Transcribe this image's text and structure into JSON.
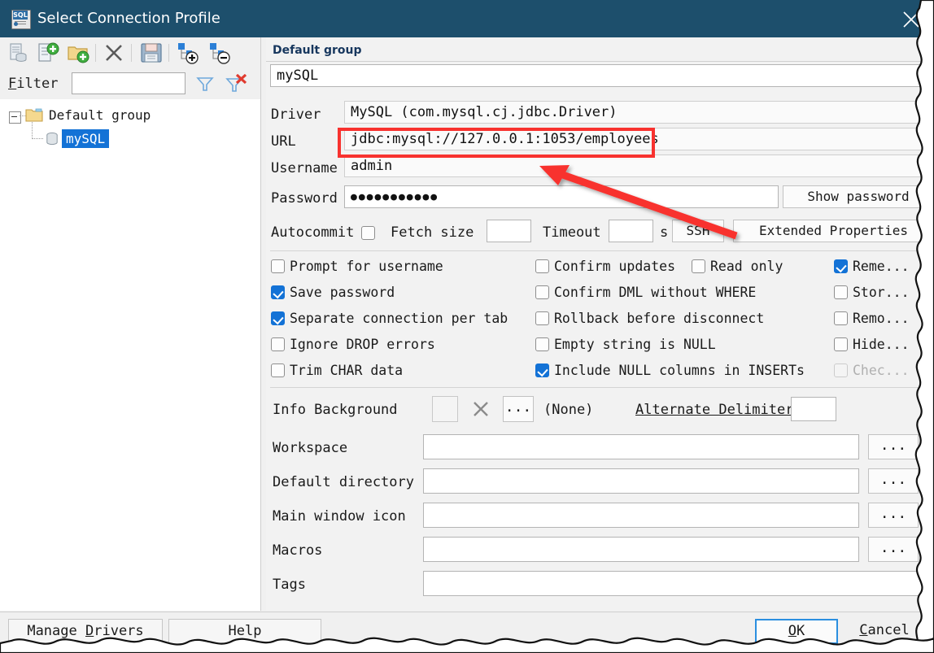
{
  "window": {
    "title": "Select Connection Profile",
    "app_icon": "sql-database-icon",
    "close_icon": "close-icon",
    "titlebar_color": "#1d4f6c"
  },
  "toolbar": {
    "buttons": [
      {
        "name": "copy-profile-button",
        "icon": "database-copy-icon"
      },
      {
        "name": "new-profile-button",
        "icon": "database-add-icon"
      },
      {
        "name": "new-group-button",
        "icon": "folder-add-icon"
      },
      {
        "name": "delete-profile-button",
        "icon": "delete-x-icon"
      },
      {
        "name": "save-profiles-button",
        "icon": "floppy-save-icon"
      },
      {
        "name": "expand-all-button",
        "icon": "tree-expand-icon"
      },
      {
        "name": "collapse-all-button",
        "icon": "tree-collapse-icon"
      }
    ]
  },
  "filter": {
    "label": "Filter",
    "mnemonic": "F",
    "value": "",
    "apply_icon": "funnel-icon",
    "clear_icon": "funnel-clear-icon"
  },
  "tree": {
    "group_label": "Default group",
    "group_icon": "folder-icon",
    "profile_label": "mySQL",
    "profile_icon": "database-icon",
    "selected": "mySQL",
    "selection_color": "#1372d6"
  },
  "details": {
    "group_header": "Default group",
    "profile_name": "mySQL",
    "fields": [
      {
        "label": "Driver",
        "value": "MySQL (com.mysql.cj.jdbc.Driver)"
      },
      {
        "label": "URL",
        "value": "jdbc:mysql://127.0.0.1:1053/employees"
      },
      {
        "label": "Username",
        "value": "admin"
      },
      {
        "label": "Password",
        "value": "●●●●●●●●●●●"
      }
    ],
    "show_password_button": "Show password",
    "options_row": {
      "autocommit_label": "Autocommit",
      "autocommit_checked": false,
      "fetch_size_label": "Fetch size",
      "fetch_size_value": "",
      "timeout_label": "Timeout",
      "timeout_value": "",
      "timeout_unit": "s",
      "ssh_button": "SSH",
      "extended_properties_button": "Extended Properties"
    },
    "checkboxes_col1": [
      {
        "label": "Prompt for username",
        "checked": false,
        "disabled": false
      },
      {
        "label": "Save password",
        "checked": true,
        "disabled": false
      },
      {
        "label": "Separate connection per tab",
        "checked": true,
        "disabled": false
      },
      {
        "label": "Ignore DROP errors",
        "checked": false,
        "disabled": false
      },
      {
        "label": "Trim CHAR data",
        "checked": false,
        "disabled": false
      }
    ],
    "checkboxes_col2": [
      {
        "label": "Confirm updates",
        "checked": false,
        "disabled": false
      },
      {
        "label": "Confirm DML without WHERE",
        "checked": false,
        "disabled": false
      },
      {
        "label": "Rollback before disconnect",
        "checked": false,
        "disabled": false
      },
      {
        "label": "Empty string is NULL",
        "checked": false,
        "disabled": false
      },
      {
        "label": "Include NULL columns in INSERTs",
        "checked": true,
        "disabled": false
      }
    ],
    "checkbox_readonly": {
      "label": "Read only",
      "checked": false,
      "disabled": false
    },
    "checkboxes_col3": [
      {
        "label": "Reme...",
        "checked": true,
        "disabled": false
      },
      {
        "label": "Stor...",
        "checked": false,
        "disabled": false
      },
      {
        "label": "Remo...",
        "checked": false,
        "disabled": false
      },
      {
        "label": "Hide...",
        "checked": false,
        "disabled": false
      },
      {
        "label": "Chec...",
        "checked": false,
        "disabled": true
      }
    ],
    "info_background": {
      "label": "Info Background",
      "swatch_value": "",
      "clear_icon": "clear-x-icon",
      "choose_button": "...",
      "value_text": "(None)"
    },
    "alternate_delimiter": {
      "label": "Alternate Delimiter",
      "value": ""
    },
    "path_rows": [
      {
        "label": "Workspace",
        "value": "",
        "browse": "..."
      },
      {
        "label": "Default directory",
        "value": "",
        "browse": "..."
      },
      {
        "label": "Main window icon",
        "value": "",
        "browse": "..."
      },
      {
        "label": "Macros",
        "value": "",
        "browse": "..."
      }
    ],
    "tags_row": {
      "label": "Tags",
      "value": ""
    }
  },
  "footer": {
    "manage_drivers": "Manage Drivers",
    "manage_drivers_mnemonic": "D",
    "help": "Help",
    "ok": "OK",
    "ok_mnemonic": "O",
    "cancel": "Cancel",
    "cancel_mnemonic": "C"
  },
  "annotations": {
    "highlight_color": "#f8322f",
    "highlight_target": "jdbc:mysql://127.0.0.1:1053/employees",
    "arrow": "red-arrow-pointing-to-url"
  }
}
